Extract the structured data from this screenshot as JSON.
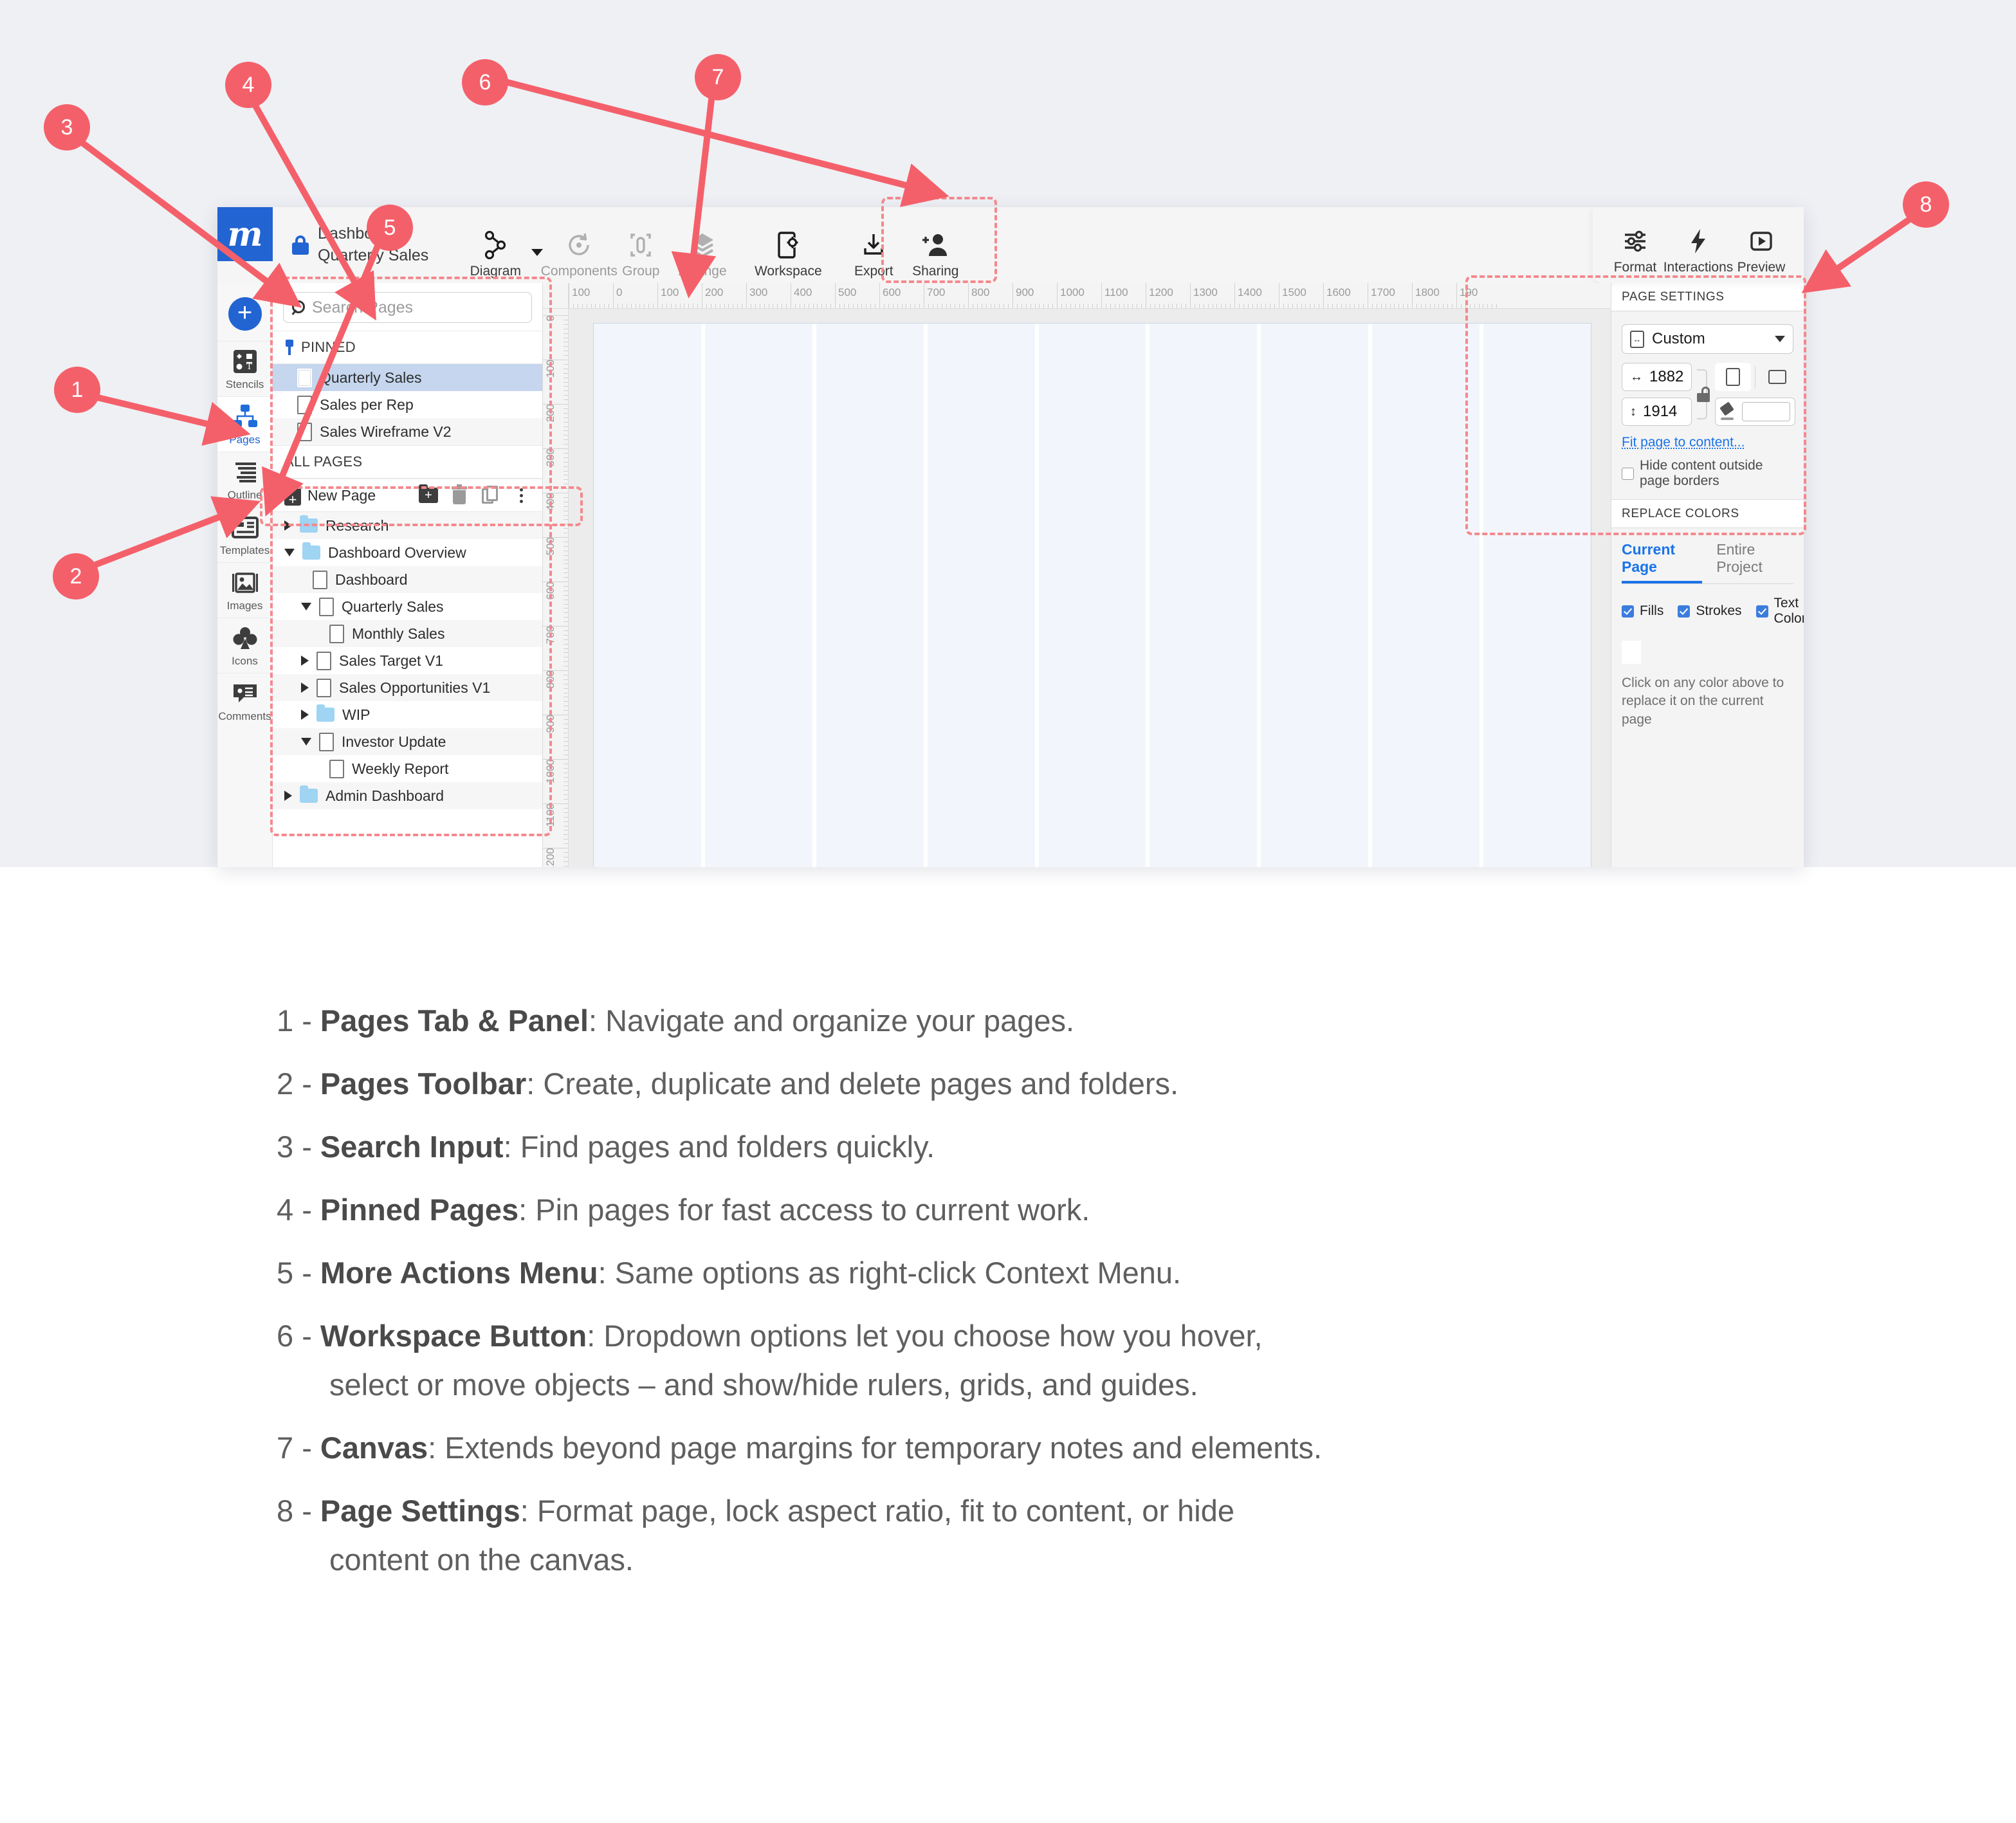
{
  "app": {
    "logo_letter": "m",
    "document": {
      "line1": "Dashboard",
      "line2": "Quarterly Sales"
    },
    "toolbar": {
      "tools": [
        {
          "label": "Diagram",
          "icon": "diagram-icon",
          "dim": false
        },
        {
          "label": "Components",
          "icon": "components-icon",
          "dim": true
        },
        {
          "label": "Group",
          "icon": "group-icon",
          "dim": true
        },
        {
          "label": "Arrange",
          "icon": "arrange-layers-icon",
          "dim": true
        },
        {
          "label": "Workspace",
          "icon": "workspace-icon",
          "dim": false
        },
        {
          "label": "Export",
          "icon": "export-download-icon",
          "dim": false
        },
        {
          "label": "Sharing",
          "icon": "add-person-icon",
          "dim": false
        }
      ],
      "right_tools": [
        {
          "label": "Format",
          "icon": "sliders-icon"
        },
        {
          "label": "Interactions",
          "icon": "lightning-bolt-icon"
        },
        {
          "label": "Preview",
          "icon": "play-box-icon"
        }
      ]
    },
    "rail": {
      "add_label": "+",
      "items": [
        {
          "label": "Stencils",
          "icon": "stencils-icon",
          "active": false
        },
        {
          "label": "Pages",
          "icon": "pages-icon",
          "active": true
        },
        {
          "label": "Outline",
          "icon": "outline-icon",
          "active": false
        },
        {
          "label": "Templates",
          "icon": "templates-icon",
          "active": false
        },
        {
          "label": "Images",
          "icon": "images-icon",
          "active": false
        },
        {
          "label": "Icons",
          "icon": "icons-clover-icon",
          "active": false
        },
        {
          "label": "Comments",
          "icon": "comments-icon",
          "active": false
        }
      ]
    },
    "pages_panel": {
      "search": {
        "placeholder": "Search Pages",
        "value": ""
      },
      "pinned_header": "PINNED",
      "pinned": [
        {
          "label": "Quarterly Sales",
          "selected": true
        },
        {
          "label": "Sales per Rep",
          "selected": false
        },
        {
          "label": "Sales Wireframe V2",
          "selected": false
        }
      ],
      "all_pages_header": "ALL PAGES",
      "toolbar": {
        "new_page_label": "New Page",
        "buttons": [
          "new-folder",
          "delete",
          "duplicate",
          "more-actions"
        ]
      },
      "tree": [
        {
          "label": "Research",
          "type": "folder",
          "depth": 0,
          "twisty": "right"
        },
        {
          "label": "Dashboard Overview",
          "type": "folder",
          "depth": 0,
          "twisty": "down"
        },
        {
          "label": "Dashboard",
          "type": "page",
          "depth": 1,
          "twisty": "none"
        },
        {
          "label": "Quarterly Sales",
          "type": "page",
          "depth": 1,
          "twisty": "down"
        },
        {
          "label": "Monthly Sales",
          "type": "page",
          "depth": 2,
          "twisty": "none"
        },
        {
          "label": "Sales Target V1",
          "type": "page",
          "depth": 1,
          "twisty": "right"
        },
        {
          "label": "Sales Opportunities V1",
          "type": "page",
          "depth": 1,
          "twisty": "right"
        },
        {
          "label": "WIP",
          "type": "folder",
          "depth": 1,
          "twisty": "right"
        },
        {
          "label": "Investor Update",
          "type": "page",
          "depth": 1,
          "twisty": "down"
        },
        {
          "label": "Weekly Report",
          "type": "page",
          "depth": 2,
          "twisty": "none"
        },
        {
          "label": "Admin Dashboard",
          "type": "folder",
          "depth": 0,
          "twisty": "right"
        }
      ]
    },
    "rulers": {
      "horizontal": [
        "100",
        "0",
        "100",
        "200",
        "300",
        "400",
        "500",
        "600",
        "700",
        "800",
        "900",
        "1000",
        "1100",
        "1200",
        "1300",
        "1400",
        "1500",
        "1600",
        "1700",
        "1800",
        "190"
      ],
      "vertical": [
        "0",
        "100",
        "200",
        "300",
        "400",
        "500",
        "600",
        "700",
        "800",
        "900",
        "1000",
        "1100",
        "1200",
        "0"
      ]
    },
    "canvas": {
      "column_count": 9
    },
    "page_settings": {
      "title": "PAGE SETTINGS",
      "preset": "Custom",
      "width": "1882",
      "height": "1914",
      "width_icon": "width-arrow-icon",
      "height_icon": "height-arrow-icon",
      "aspect_lock": "unlocked",
      "orientation": "portrait",
      "fill_value": "",
      "fit_link": "Fit page to content...",
      "hide_content_label": "Hide content outside page borders",
      "hide_content_checked": false
    },
    "replace_colors": {
      "title": "REPLACE COLORS",
      "tabs": [
        {
          "label": "Current Page",
          "active": true
        },
        {
          "label": "Entire Project",
          "active": false
        }
      ],
      "checkboxes": [
        {
          "label": "Fills",
          "checked": true
        },
        {
          "label": "Strokes",
          "checked": true
        },
        {
          "label": "Text Color",
          "checked": true
        }
      ],
      "swatch_color": "#ffffff",
      "hint": "Click on any color above to replace it on the current page"
    }
  },
  "callouts": [
    {
      "num": "1"
    },
    {
      "num": "2"
    },
    {
      "num": "3"
    },
    {
      "num": "4"
    },
    {
      "num": "5"
    },
    {
      "num": "6"
    },
    {
      "num": "7"
    },
    {
      "num": "8"
    }
  ],
  "legend": [
    {
      "num": "1 - ",
      "term": "Pages Tab & Panel",
      "rest": ": Navigate and organize your pages.",
      "cont": ""
    },
    {
      "num": "2 - ",
      "term": "Pages Toolbar",
      "rest": ": Create, duplicate and delete pages and folders.",
      "cont": ""
    },
    {
      "num": "3 - ",
      "term": "Search Input",
      "rest": ": Find pages and folders quickly.",
      "cont": ""
    },
    {
      "num": "4 - ",
      "term": "Pinned Pages",
      "rest": ": Pin pages for fast access to current work.",
      "cont": ""
    },
    {
      "num": "5 - ",
      "term": "More Actions Menu",
      "rest": ": Same options as right-click Context Menu.",
      "cont": ""
    },
    {
      "num": "6 - ",
      "term": "Workspace Button",
      "rest": ": Dropdown options let you choose how you hover,",
      "cont": "select or move objects – and show/hide rulers, grids, and guides."
    },
    {
      "num": "7 - ",
      "term": "Canvas",
      "rest": ": Extends beyond page margins for temporary notes and elements.",
      "cont": ""
    },
    {
      "num": "8 - ",
      "term": "Page Settings",
      "rest": ": Format page, lock aspect ratio, fit to content, or hide",
      "cont": "content on the canvas."
    }
  ],
  "colors": {
    "accent_red": "#f4606a",
    "brand_blue": "#2264d1",
    "link_blue": "#1a73e8"
  }
}
